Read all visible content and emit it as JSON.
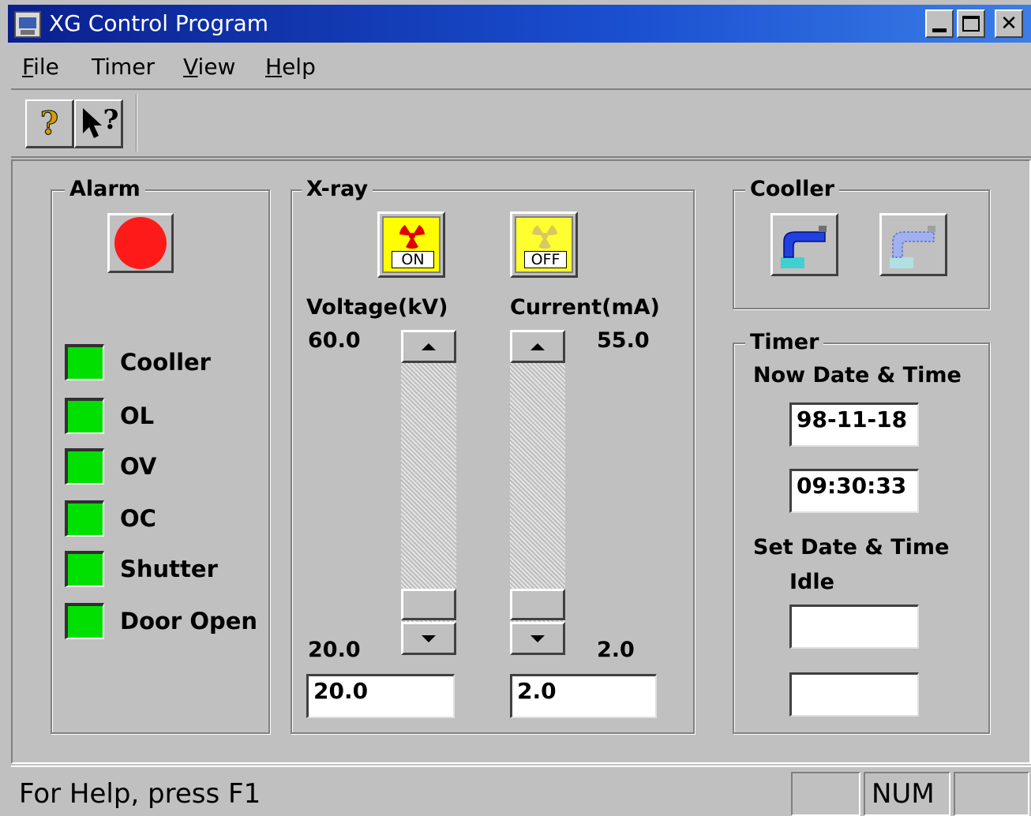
{
  "window": {
    "title": "XG Control Program"
  },
  "menu": {
    "items": [
      "File",
      "Timer",
      "View",
      "Help"
    ]
  },
  "toolbar": {
    "help_glyph": "?",
    "context_help_glyph": "?"
  },
  "alarm": {
    "title": "Alarm",
    "indicators": [
      "Cooller",
      "OL",
      "OV",
      "OC",
      "Shutter",
      "Door Open"
    ],
    "indicator_color": "#00e000",
    "alarm_color": "#ff1a1a"
  },
  "xray": {
    "title": "X-ray",
    "on_label": "ON",
    "off_label": "OFF",
    "voltage": {
      "label": "Voltage(kV)",
      "max": "60.0",
      "min": "20.0",
      "value": "20.0"
    },
    "current": {
      "label": "Current(mA)",
      "max": "55.0",
      "min": "2.0",
      "value": "2.0"
    }
  },
  "cooler": {
    "title": "Cooller"
  },
  "timer": {
    "title": "Timer",
    "now_label": "Now Date & Time",
    "now_date": "98-11-18",
    "now_time": "09:30:33",
    "set_label": "Set Date & Time",
    "state": "Idle",
    "set_date": "",
    "set_time": ""
  },
  "status": {
    "text": "For Help, press F1",
    "num_indicator": "NUM"
  }
}
